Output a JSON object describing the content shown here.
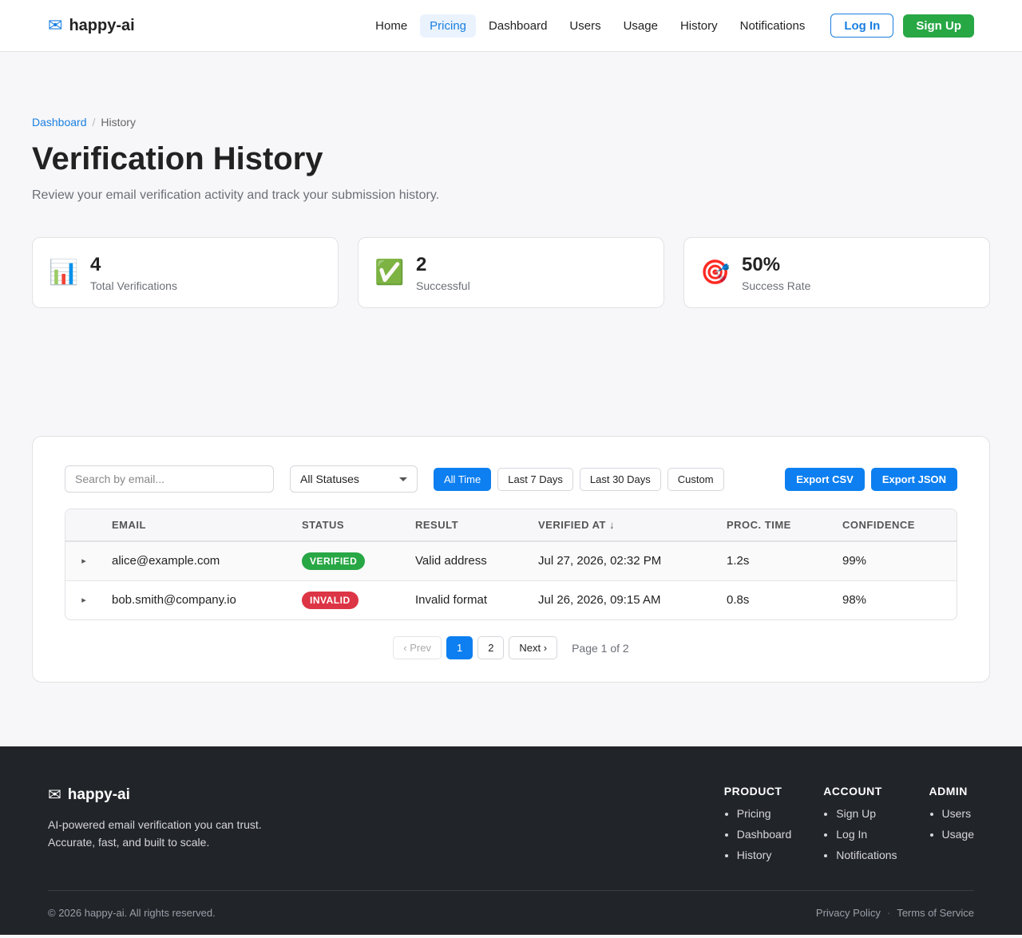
{
  "header": {
    "brand": "happy-ai",
    "nav": [
      "Home",
      "Pricing",
      "Dashboard",
      "Users",
      "Usage",
      "History",
      "Notifications"
    ],
    "active_nav": "Pricing",
    "login_label": "Log In",
    "signup_label": "Sign Up"
  },
  "breadcrumb": {
    "parent": "Dashboard",
    "sep": "/",
    "current": "History"
  },
  "page": {
    "title": "Verification History",
    "subtitle": "Review your email verification activity and track your submission history."
  },
  "stats": [
    {
      "icon": "📊",
      "icon_name": "bar-chart-icon",
      "value": "4",
      "label": "Total Verifications"
    },
    {
      "icon": "✅",
      "icon_name": "check-icon",
      "value": "2",
      "label": "Successful"
    },
    {
      "icon": "🎯",
      "icon_name": "target-icon",
      "value": "50%",
      "label": "Success Rate"
    }
  ],
  "filters": {
    "search_placeholder": "Search by email...",
    "status_selected": "All Statuses",
    "ranges": [
      "All Time",
      "Last 7 Days",
      "Last 30 Days",
      "Custom"
    ],
    "active_range": "All Time",
    "export_csv": "Export CSV",
    "export_json": "Export JSON"
  },
  "table": {
    "columns": [
      "EMAIL",
      "STATUS",
      "RESULT",
      "VERIFIED AT ↓",
      "PROC. TIME",
      "CONFIDENCE"
    ],
    "rows": [
      {
        "expand": "▸",
        "email": "alice@example.com",
        "status": "VERIFIED",
        "status_kind": "verified",
        "result": "Valid address",
        "verified_at": "Jul 27, 2026, 02:32 PM",
        "proc_time": "1.2s",
        "confidence": "99%"
      },
      {
        "expand": "▸",
        "email": "bob.smith@company.io",
        "status": "INVALID",
        "status_kind": "invalid",
        "result": "Invalid format",
        "verified_at": "Jul 26, 2026, 09:15 AM",
        "proc_time": "0.8s",
        "confidence": "98%"
      }
    ]
  },
  "pagination": {
    "prev": "‹ Prev",
    "pages": [
      "1",
      "2"
    ],
    "current": "1",
    "next": "Next ›",
    "info": "Page 1 of 2"
  },
  "footer": {
    "brand": "happy-ai",
    "tagline_1": "AI-powered email verification you can trust.",
    "tagline_2": "Accurate, fast, and built to scale.",
    "columns": [
      {
        "title": "PRODUCT",
        "links": [
          "Pricing",
          "Dashboard",
          "History"
        ]
      },
      {
        "title": "ACCOUNT",
        "links": [
          "Sign Up",
          "Log In",
          "Notifications"
        ]
      },
      {
        "title": "ADMIN",
        "links": [
          "Users",
          "Usage"
        ]
      }
    ],
    "copyright": "© 2026 happy-ai. All rights reserved.",
    "privacy": "Privacy Policy",
    "legal_sep": "·",
    "terms": "Terms of Service"
  },
  "colors": {
    "accent": "#0d7ff0",
    "success": "#28a745",
    "danger": "#dc3545",
    "footer_bg": "#212429"
  }
}
